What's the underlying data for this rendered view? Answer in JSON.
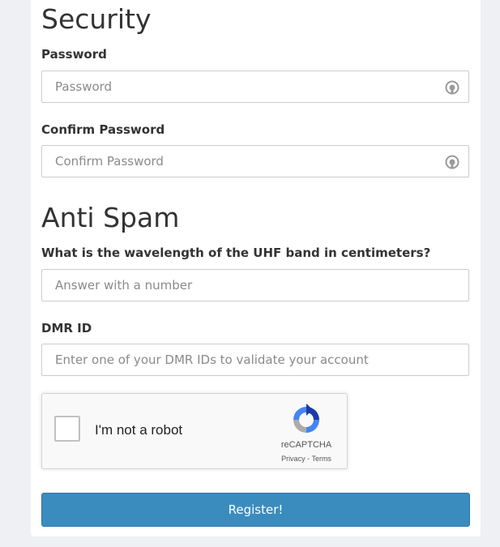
{
  "security": {
    "title": "Security",
    "password": {
      "label": "Password",
      "placeholder": "Password",
      "value": ""
    },
    "confirm_password": {
      "label": "Confirm Password",
      "placeholder": "Confirm Password",
      "value": ""
    }
  },
  "anti_spam": {
    "title": "Anti Spam",
    "question": {
      "label": "What is the wavelength of the UHF band in centimeters?",
      "placeholder": "Answer with a number",
      "value": ""
    },
    "dmr_id": {
      "label": "DMR ID",
      "placeholder": "Enter one of your DMR IDs to validate your account",
      "value": ""
    }
  },
  "captcha": {
    "label": "I'm not a robot",
    "brand": "reCAPTCHA",
    "privacy": "Privacy",
    "separator": "-",
    "terms": "Terms",
    "checked": false
  },
  "register_button": {
    "label": "Register!",
    "color": "#3a8cbf"
  },
  "icons": {
    "password_field_icon": "password-manager-icon",
    "recaptcha_logo": "recaptcha-logo-icon"
  }
}
